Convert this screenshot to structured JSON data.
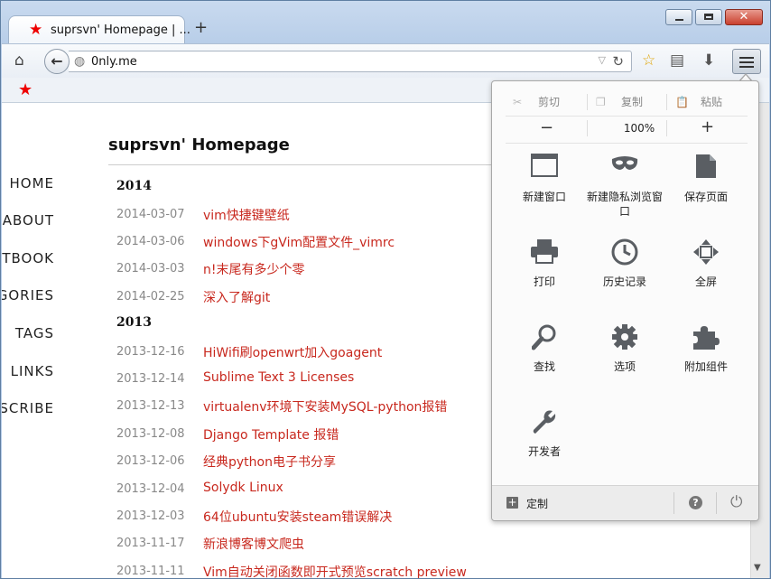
{
  "browser": {
    "tab_title": "suprsvn' Homepage | ...",
    "new_tab_label": "+",
    "url": "0nly.me"
  },
  "page": {
    "title": "suprsvn' Homepage",
    "nav": [
      "HOME",
      "ABOUT",
      "TBOOK",
      "GORIES",
      "TAGS",
      "LINKS",
      "SCRIBE"
    ],
    "years": [
      "2014",
      "2013"
    ],
    "posts_2014": [
      {
        "date": "2014-03-07",
        "title": "vim快捷键壁纸"
      },
      {
        "date": "2014-03-06",
        "title": "windows下gVim配置文件_vimrc"
      },
      {
        "date": "2014-03-03",
        "title": "n!末尾有多少个零"
      },
      {
        "date": "2014-02-25",
        "title": "深入了解git"
      }
    ],
    "posts_2013": [
      {
        "date": "2013-12-16",
        "title": "HiWifi刷openwrt加入goagent"
      },
      {
        "date": "2013-12-14",
        "title": "Sublime Text 3 Licenses"
      },
      {
        "date": "2013-12-13",
        "title": "virtualenv环境下安装MySQL-python报错"
      },
      {
        "date": "2013-12-08",
        "title": "Django Template 报错"
      },
      {
        "date": "2013-12-06",
        "title": "经典python电子书分享"
      },
      {
        "date": "2013-12-04",
        "title": "Solydk Linux"
      },
      {
        "date": "2013-12-03",
        "title": "64位ubuntu安装steam错误解决"
      },
      {
        "date": "2013-11-17",
        "title": "新浪博客博文爬虫"
      },
      {
        "date": "2013-11-11",
        "title": "Vim自动关闭函数即开式预览scratch preview"
      }
    ]
  },
  "menu_panel": {
    "cut": "剪切",
    "copy": "复制",
    "paste": "粘贴",
    "zoom_out": "−",
    "zoom_level": "100%",
    "zoom_in": "+",
    "items": [
      {
        "label": "新建窗口",
        "icon": "new-window-icon"
      },
      {
        "label": "新建隐私浏览窗口",
        "icon": "private-mask-icon"
      },
      {
        "label": "保存页面",
        "icon": "save-page-icon"
      },
      {
        "label": "打印",
        "icon": "printer-icon"
      },
      {
        "label": "历史记录",
        "icon": "history-clock-icon"
      },
      {
        "label": "全屏",
        "icon": "fullscreen-icon"
      },
      {
        "label": "查找",
        "icon": "magnifier-icon"
      },
      {
        "label": "选项",
        "icon": "gear-icon"
      },
      {
        "label": "附加组件",
        "icon": "puzzle-icon"
      },
      {
        "label": "开发者",
        "icon": "wrench-icon"
      }
    ],
    "customize": "定制"
  }
}
